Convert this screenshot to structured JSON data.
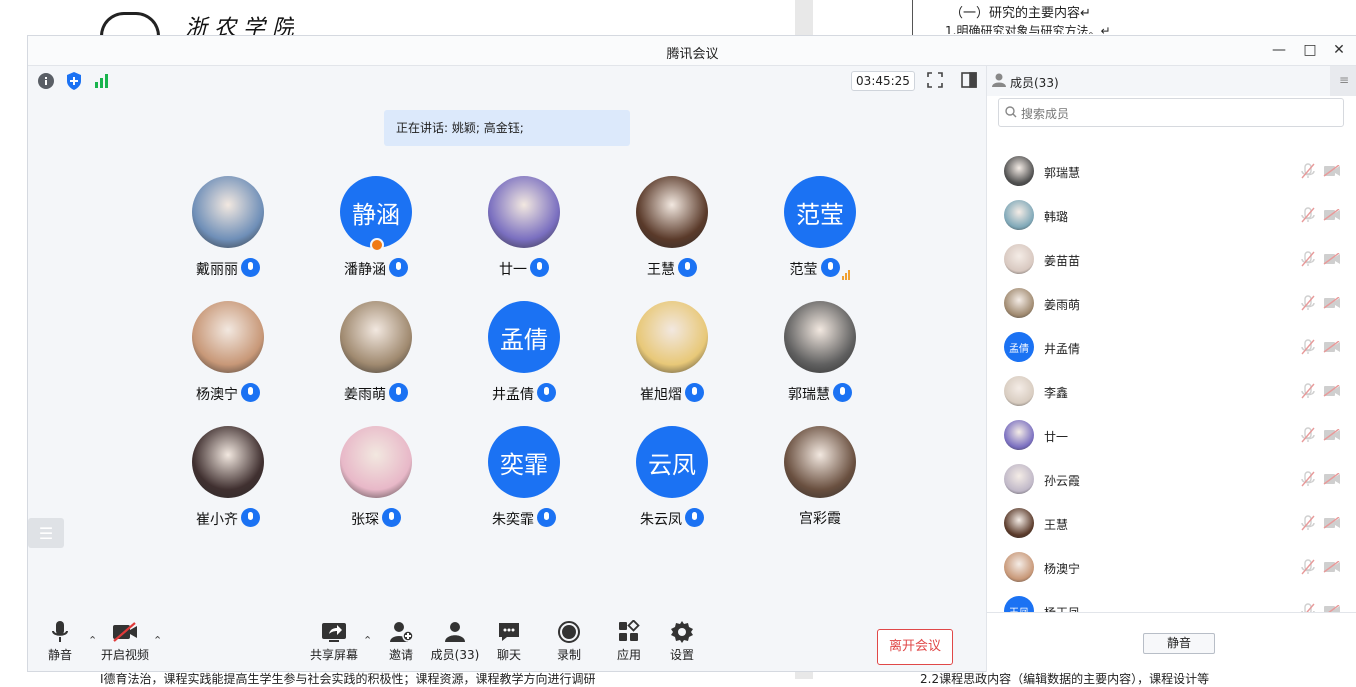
{
  "background_doc": {
    "logo_text": "浙 农 学 院",
    "heading": "（一）研究的主要内容↵",
    "subheading": "1.明确研究对象与研究方法。↵",
    "bottom_text": "I德育法治，课程实践能提高生学生参与社会实践的积极性；课程资源，课程教学方向进行调研",
    "bottom_text_right": "2.2课程思政内容（编辑数据的主要内容），课程设计等"
  },
  "window": {
    "title": "腾讯会议",
    "timer": "03:45:25",
    "speaking_banner": "正在讲话: 姚颖; 高金钰;"
  },
  "participants": [
    {
      "name": "戴丽丽",
      "avatar": "photo",
      "color": "#6f8fb8"
    },
    {
      "name": "潘静涵",
      "avatar": "text",
      "avatar_text": "静涵",
      "host": true
    },
    {
      "name": "廿一",
      "avatar": "photo",
      "color": "#7a6fc0"
    },
    {
      "name": "王慧",
      "avatar": "photo",
      "color": "#5a3a2a"
    },
    {
      "name": "范莹",
      "avatar": "text",
      "avatar_text": "范莹",
      "signal": true
    },
    {
      "name": "杨澳宁",
      "avatar": "photo",
      "color": "#c89878"
    },
    {
      "name": "姜雨萌",
      "avatar": "photo",
      "color": "#a08a70"
    },
    {
      "name": "井孟倩",
      "avatar": "text",
      "avatar_text": "孟倩"
    },
    {
      "name": "崔旭熠",
      "avatar": "photo",
      "color": "#e8c878"
    },
    {
      "name": "郭瑞慧",
      "avatar": "photo",
      "color": "#606060"
    },
    {
      "name": "崔小齐",
      "avatar": "photo",
      "color": "#403030"
    },
    {
      "name": "张琛",
      "avatar": "photo",
      "color": "#e8b8c8"
    },
    {
      "name": "朱奕霏",
      "avatar": "text",
      "avatar_text": "奕霏"
    },
    {
      "name": "朱云凤",
      "avatar": "text",
      "avatar_text": "云凤"
    },
    {
      "name": "宫彩霞",
      "avatar": "photo",
      "color": "#6a5040",
      "no_mic": true
    }
  ],
  "toolbar": {
    "mute": "静音",
    "video": "开启视频",
    "share": "共享屏幕",
    "invite": "邀请",
    "members": "成员(33)",
    "chat": "聊天",
    "record": "录制",
    "apps": "应用",
    "settings": "设置",
    "leave": "离开会议"
  },
  "panel": {
    "title": "成员(33)",
    "search_placeholder": "搜索成员",
    "mute_all": "静音",
    "members": [
      {
        "name": "郭瑞慧",
        "color": "#505050"
      },
      {
        "name": "韩璐",
        "color": "#7fa8b8"
      },
      {
        "name": "姜苗苗",
        "color": "#d8c8c0"
      },
      {
        "name": "姜雨萌",
        "color": "#a08a70"
      },
      {
        "name": "井孟倩",
        "color": "#1b72f3",
        "text": "孟倩"
      },
      {
        "name": "李鑫",
        "color": "#d8ccc0"
      },
      {
        "name": "廿一",
        "color": "#7a6fc0"
      },
      {
        "name": "孙云霞",
        "color": "#c0b8c8"
      },
      {
        "name": "王慧",
        "color": "#5a3a2a"
      },
      {
        "name": "杨澳宁",
        "color": "#c89878"
      },
      {
        "name": "杨玉凤",
        "color": "#1b72f3",
        "text": "玉凤"
      }
    ]
  }
}
